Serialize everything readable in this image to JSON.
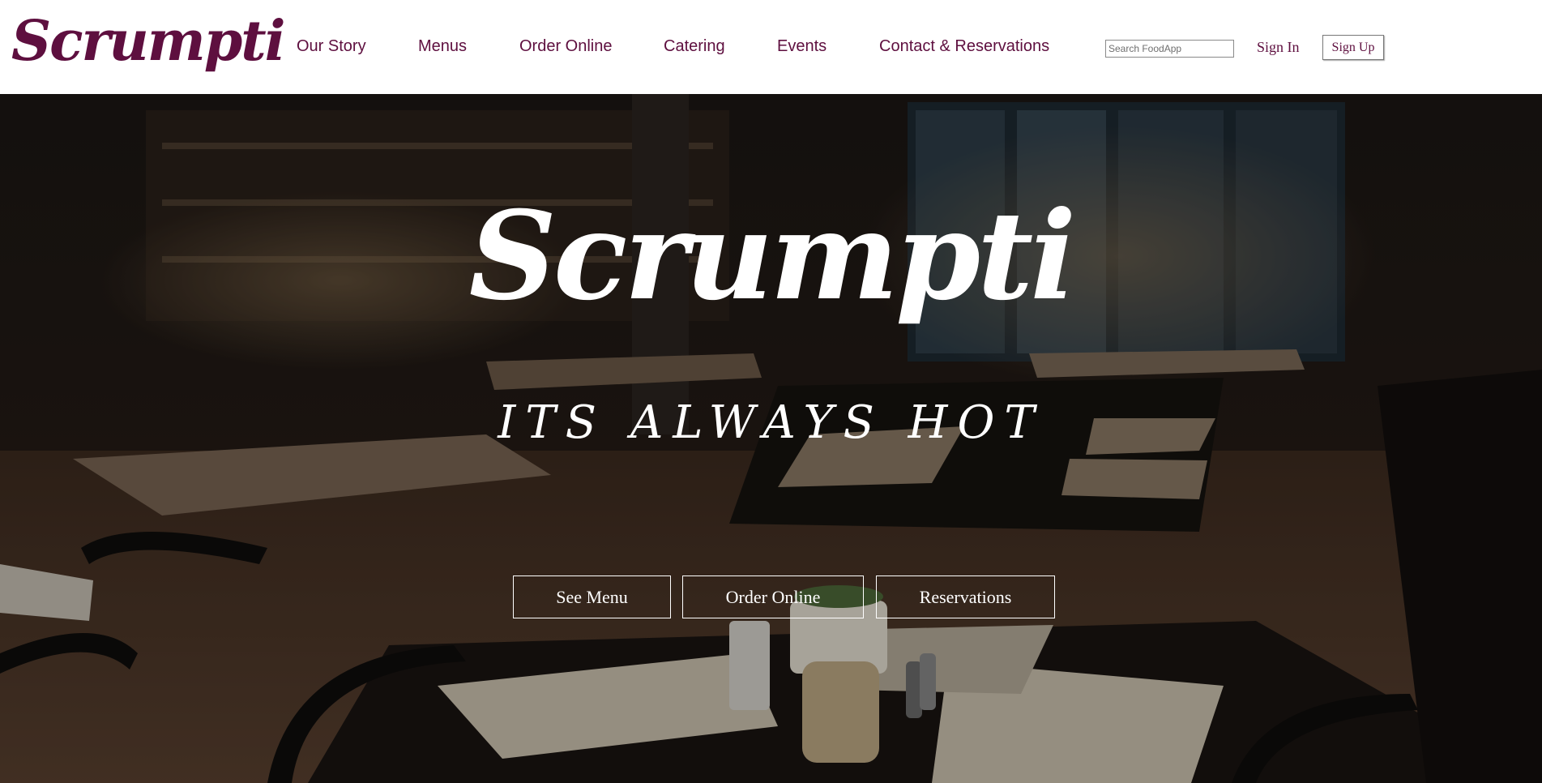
{
  "header": {
    "logo": "Scrumpti",
    "nav": [
      {
        "label": "Our Story"
      },
      {
        "label": "Menus"
      },
      {
        "label": "Order Online"
      },
      {
        "label": "Catering"
      },
      {
        "label": "Events"
      },
      {
        "label": "Contact & Reservations"
      }
    ],
    "search": {
      "placeholder": "Search FoodApp",
      "value": ""
    },
    "sign_in": "Sign In",
    "sign_up": "Sign Up"
  },
  "hero": {
    "title": "Scrumpti",
    "tagline": "ITS ALWAYS HOT",
    "buttons": [
      {
        "label": "See Menu"
      },
      {
        "label": "Order Online"
      },
      {
        "label": "Reservations"
      }
    ]
  },
  "colors": {
    "brand": "#5e0f3f",
    "hero_text": "#ffffff",
    "header_bg": "#ffffff"
  }
}
